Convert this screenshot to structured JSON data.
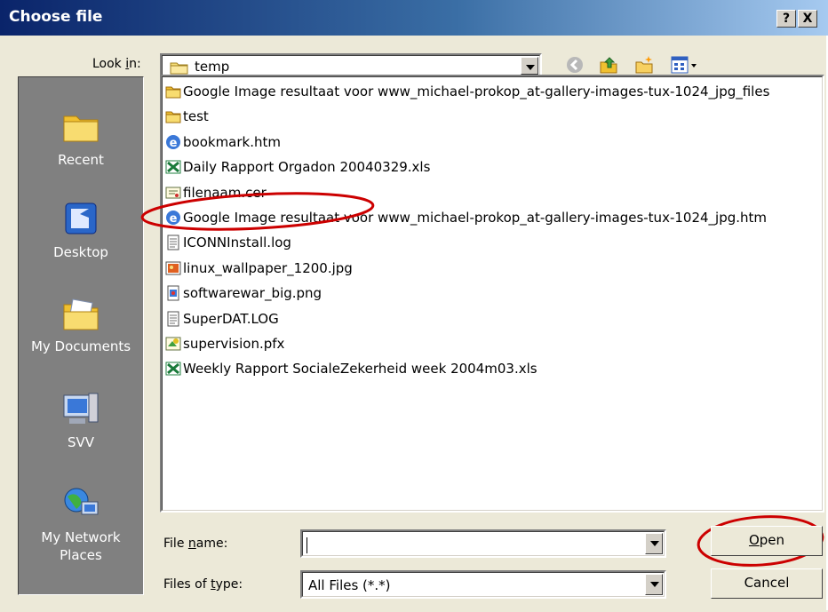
{
  "window": {
    "title": "Choose file",
    "help_label": "?",
    "close_label": "X"
  },
  "lookin": {
    "label_pre": "Look ",
    "label_key": "i",
    "label_post": "n:",
    "value": "temp"
  },
  "toolbar": [
    "back-icon",
    "up-folder-icon",
    "new-folder-icon",
    "view-menu-icon"
  ],
  "places": [
    {
      "label": "Recent",
      "icon": "recent-folder-icon"
    },
    {
      "label": "Desktop",
      "icon": "desktop-icon"
    },
    {
      "label": "My Documents",
      "icon": "my-documents-icon"
    },
    {
      "label": "SVV",
      "icon": "computer-icon"
    },
    {
      "label": "My Network Places",
      "icon": "network-icon"
    }
  ],
  "files": [
    {
      "name": "Google Image resultaat voor www_michael-prokop_at-gallery-images-tux-1024_jpg_files",
      "type": "folder"
    },
    {
      "name": "test",
      "type": "folder"
    },
    {
      "name": "bookmark.htm",
      "type": "htm"
    },
    {
      "name": "Daily Rapport Orgadon 20040329.xls",
      "type": "xls"
    },
    {
      "name": "filenaam.cer",
      "type": "cer"
    },
    {
      "name": "Google Image resultaat voor www_michael-prokop_at-gallery-images-tux-1024_jpg.htm",
      "type": "htm"
    },
    {
      "name": "ICONNInstall.log",
      "type": "log"
    },
    {
      "name": "linux_wallpaper_1200.jpg",
      "type": "jpg"
    },
    {
      "name": "softwarewar_big.png",
      "type": "png"
    },
    {
      "name": "SuperDAT.LOG",
      "type": "log"
    },
    {
      "name": "supervision.pfx",
      "type": "pfx"
    },
    {
      "name": "Weekly Rapport SocialeZekerheid week 2004m03.xls",
      "type": "xls"
    }
  ],
  "filename": {
    "label_pre": "File ",
    "label_key": "n",
    "label_post": "ame:",
    "value": ""
  },
  "filetype": {
    "label_pre": "Files of ",
    "label_key": "t",
    "label_post": "ype:",
    "value": "All Files (*.*)"
  },
  "buttons": {
    "open_key": "O",
    "open_rest": "pen",
    "cancel": "Cancel"
  },
  "annotation_color": "#cc0000"
}
